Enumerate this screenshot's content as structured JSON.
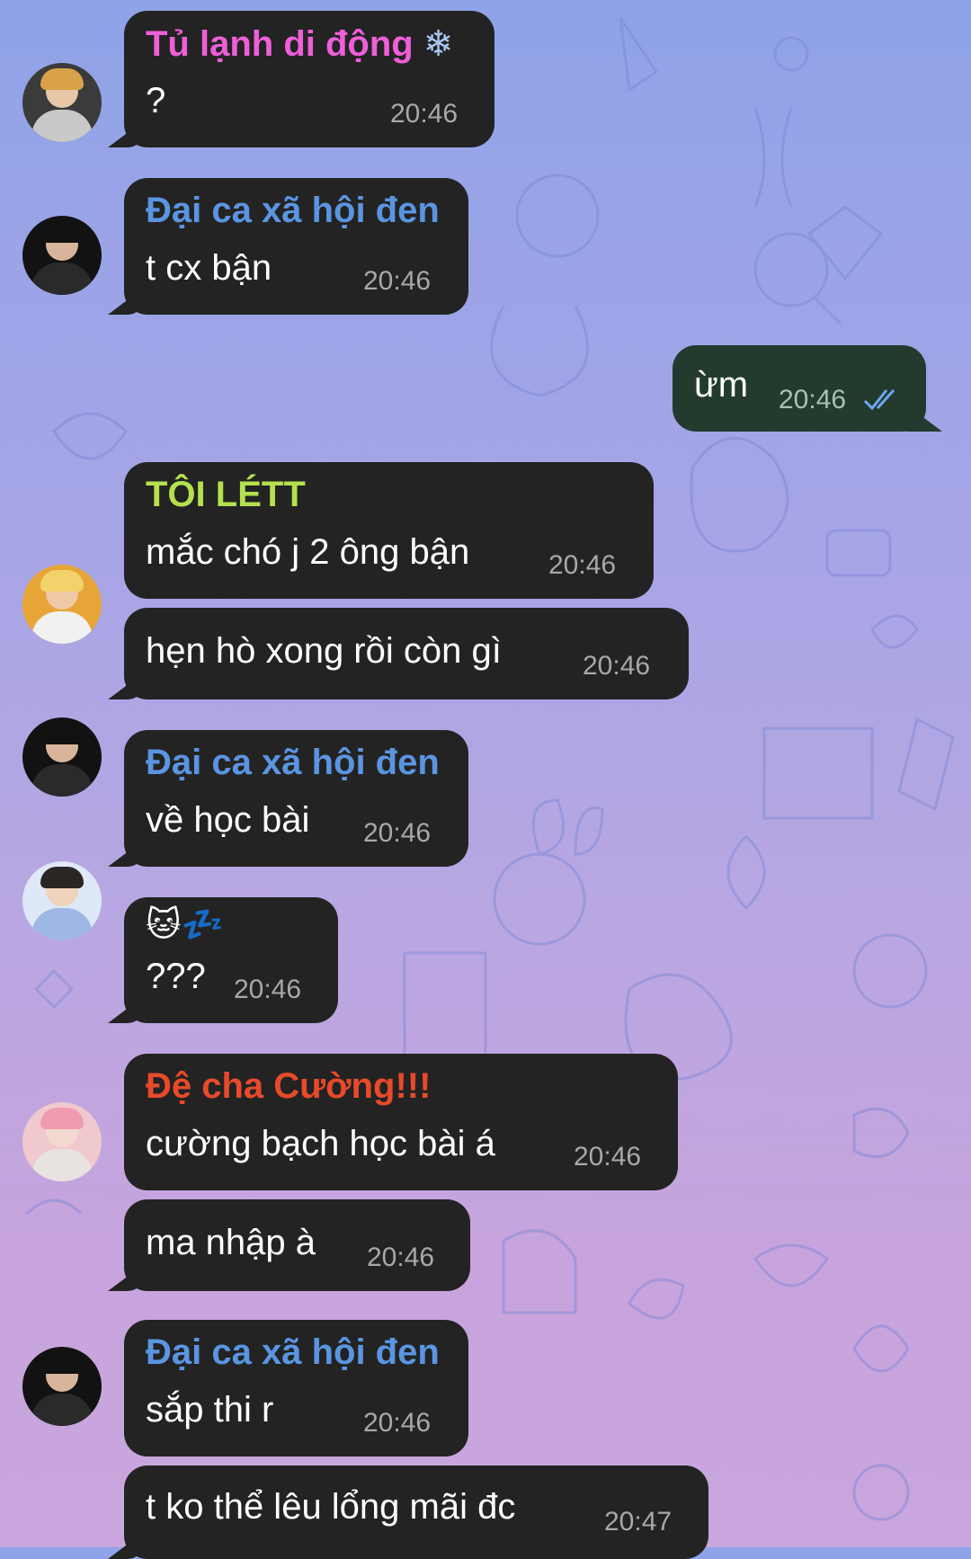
{
  "colors": {
    "bubble_in": "#232323",
    "bubble_out": "#233b2e",
    "name_pink": "#ee5fd8",
    "name_blue": "#5a95e2",
    "name_green": "#b4e14d",
    "name_red": "#e84a2a",
    "time": "#a8a8a8",
    "read_ticks": "#6fa6f2"
  },
  "messages": [
    {
      "sender": "Tủ lạnh di động",
      "sender_icon": "snowflake-icon",
      "text": "?",
      "time": "20:46"
    },
    {
      "sender": "Đại ca xã hội đen",
      "text": "t cx bận",
      "time": "20:46"
    },
    {
      "text": "ừm",
      "time": "20:46",
      "outgoing": true,
      "status_icon": "double-check-icon"
    },
    {
      "sender": "TÔI LÉTT",
      "text": "mắc chó j 2 ông bận",
      "time": "20:46"
    },
    {
      "text": "hẹn hò xong rồi còn gì",
      "time": "20:46"
    },
    {
      "sender": "Đại ca xã hội đen",
      "text": "về học bài",
      "time": "20:46"
    },
    {
      "sender_emoji": "🐱💤",
      "text": "???",
      "time": "20:46"
    },
    {
      "sender": "Đệ cha Cường!!!",
      "text": "cường bạch học bài á",
      "time": "20:46"
    },
    {
      "text": "ma nhập à",
      "time": "20:46"
    },
    {
      "sender": "Đại ca xã hội đen",
      "text": "sắp thi r",
      "time": "20:46"
    },
    {
      "text": "t ko thể lêu lổng mãi đc",
      "time": "20:47"
    }
  ]
}
